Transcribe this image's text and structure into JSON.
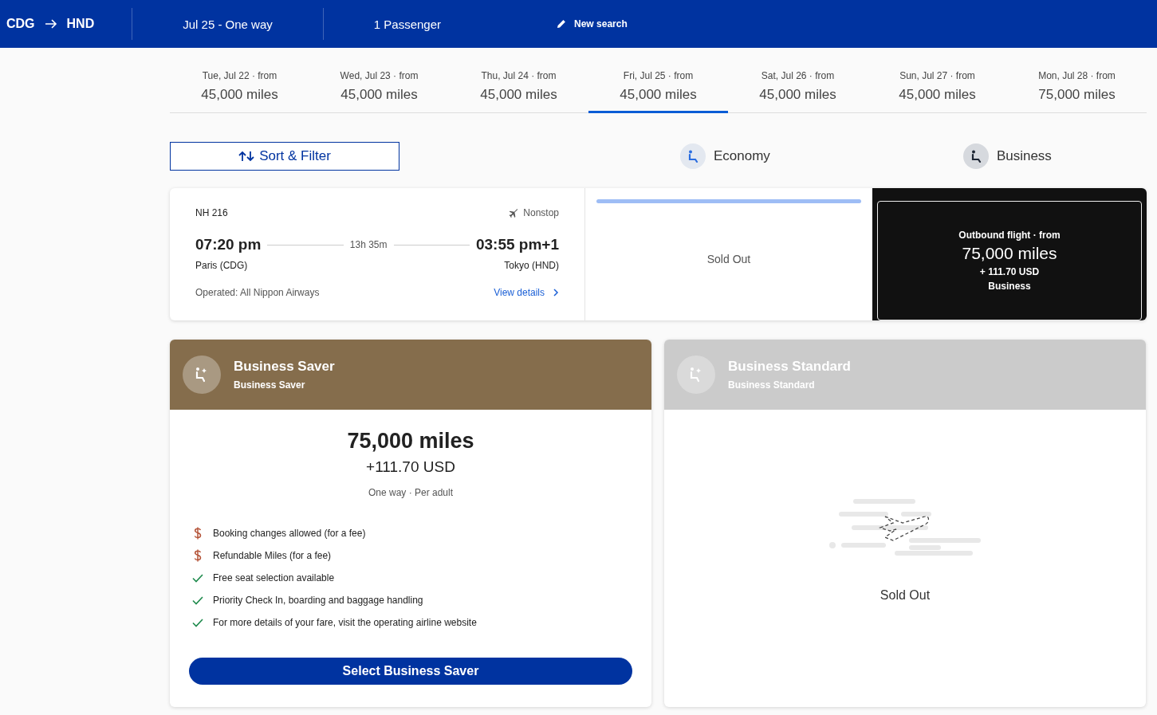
{
  "header": {
    "origin": "CDG",
    "destination": "HND",
    "date": "Jul 25 - One way",
    "passengers": "1 Passenger",
    "new_search": "New search"
  },
  "date_tabs": [
    {
      "day": "Tue, Jul 22 · from",
      "price": "45,000 miles",
      "selected": false
    },
    {
      "day": "Wed, Jul 23 · from",
      "price": "45,000 miles",
      "selected": false
    },
    {
      "day": "Thu, Jul 24 · from",
      "price": "45,000 miles",
      "selected": false
    },
    {
      "day": "Fri, Jul 25 · from",
      "price": "45,000 miles",
      "selected": true
    },
    {
      "day": "Sat, Jul 26 · from",
      "price": "45,000 miles",
      "selected": false
    },
    {
      "day": "Sun, Jul 27 · from",
      "price": "45,000 miles",
      "selected": false
    },
    {
      "day": "Mon, Jul 28 · from",
      "price": "75,000 miles",
      "selected": false
    }
  ],
  "sort_filter": "Sort & Filter",
  "cabins": [
    {
      "label": "Economy",
      "selected": false
    },
    {
      "label": "Business",
      "selected": true
    }
  ],
  "flight": {
    "number": "NH 216",
    "stops": "Nonstop",
    "depart_time": "07:20 pm",
    "duration": "13h 35m",
    "arrive_time": "03:55 pm+1",
    "origin": "Paris (CDG)",
    "destination": "Tokyo (HND)",
    "operator": "Operated: All Nippon Airways",
    "details_link": "View details",
    "fares": [
      {
        "kind": "sold_out",
        "label": "Sold Out",
        "selected": false
      },
      {
        "kind": "price",
        "heading": "Outbound flight · from",
        "miles": "75,000 miles",
        "cash": "+ 111.70 USD",
        "cabin": "Business",
        "selected": true
      }
    ]
  },
  "fare_cards": [
    {
      "kind": "available",
      "title": "Business Saver",
      "subtitle": "Business Saver",
      "miles": "75,000 miles",
      "cash": "+111.70 USD",
      "note": "One way · Per adult",
      "features": [
        {
          "kind": "fee",
          "text": "Booking changes allowed (for a fee)"
        },
        {
          "kind": "fee",
          "text": "Refundable Miles (for a fee)"
        },
        {
          "kind": "included",
          "text": "Free seat selection available"
        },
        {
          "kind": "included",
          "text": "Priority Check In, boarding and baggage handling"
        },
        {
          "kind": "included",
          "text": "For more details of your fare, visit the operating airline website"
        }
      ],
      "button": "Select Business Saver"
    },
    {
      "kind": "sold_out",
      "title": "Business Standard",
      "subtitle": "Business Standard",
      "label": "Sold Out"
    }
  ]
}
